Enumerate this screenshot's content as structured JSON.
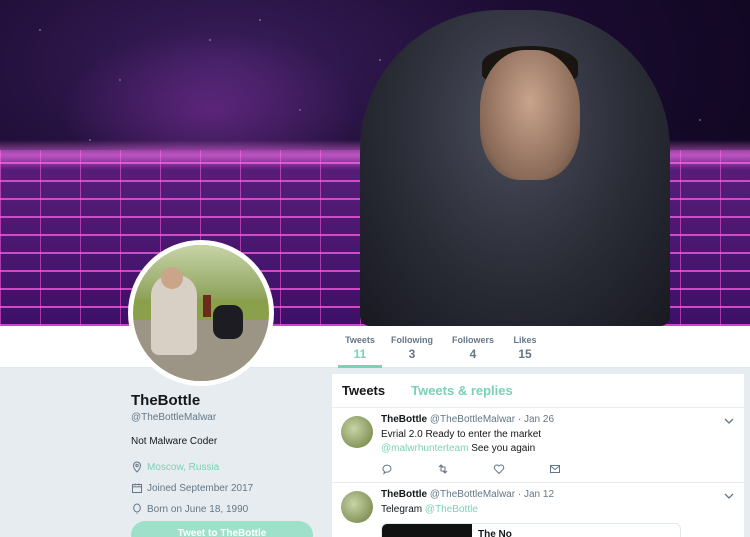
{
  "profile": {
    "name": "TheBottle",
    "handle": "@TheBottleMalwar",
    "bio": "Not Malware Coder",
    "location": "Moscow, Russia",
    "joined": "Joined September 2017",
    "born": "Born on June 18, 1990",
    "tweet_to_button": "Tweet to TheBottle"
  },
  "stats": [
    {
      "label": "Tweets",
      "value": "11"
    },
    {
      "label": "Following",
      "value": "3"
    },
    {
      "label": "Followers",
      "value": "4"
    },
    {
      "label": "Likes",
      "value": "15"
    }
  ],
  "timeline": {
    "tabs": [
      "Tweets",
      "Tweets & replies"
    ],
    "tweets": [
      {
        "name": "TheBottle",
        "handle": "@TheBottleMalwar",
        "date": "Jan 26",
        "text": "Evrial 2.0 Ready to enter the market",
        "mention": "@malwrhunterteam",
        "text_after": "See you again"
      },
      {
        "name": "TheBottle",
        "handle": "@TheBottleMalwar",
        "date": "Jan 12",
        "text": "Telegram",
        "mention": "@TheBottle",
        "card_title": "The No"
      }
    ]
  },
  "colors": {
    "accent": "#79d2b6",
    "muted": "#657786",
    "background": "#e6ecf0"
  }
}
